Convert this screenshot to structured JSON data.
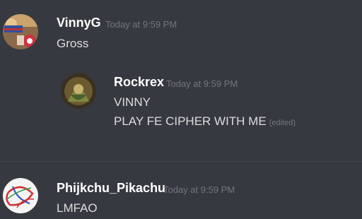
{
  "messages": [
    {
      "username": "VinnyG",
      "timestamp": "Today at 9:59 PM",
      "lines": [
        "Gross"
      ],
      "avatar_icon": "user-avatar-vinnyg"
    },
    {
      "username": "Rockrex",
      "timestamp": "Today at 9:59 PM",
      "lines": [
        "VINNY",
        "PLAY FE CIPHER WITH ME"
      ],
      "edited_label": "(edited)",
      "avatar_icon": "user-avatar-rockrex"
    },
    {
      "username": "Phijkchu_Pikachu",
      "timestamp": "Today at 9:59 PM",
      "lines": [
        "LMFAO"
      ],
      "avatar_icon": "user-avatar-phijkchu"
    }
  ],
  "colors": {
    "background": "#36393f",
    "username": "#ffffff",
    "timestamp": "#72767d",
    "message_text": "#dcddde"
  }
}
